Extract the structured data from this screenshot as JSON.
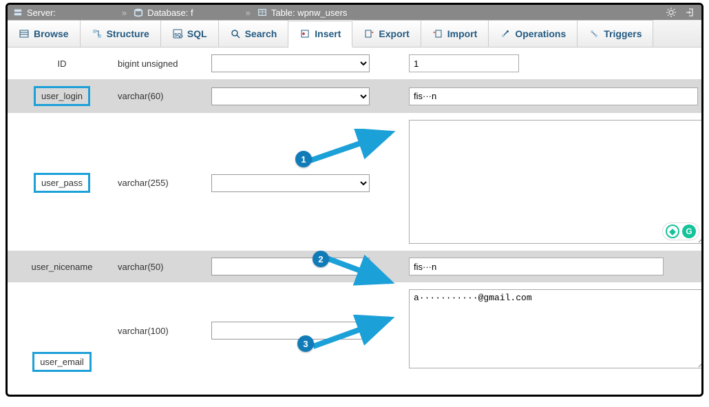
{
  "breadcrumb": {
    "server_label": "Server:",
    "server_value": "",
    "db_label": "Database: f",
    "db_value": "",
    "table_label": "Table: wpnw_users"
  },
  "tabs": [
    {
      "label": "Browse",
      "icon": "browse"
    },
    {
      "label": "Structure",
      "icon": "structure"
    },
    {
      "label": "SQL",
      "icon": "sql"
    },
    {
      "label": "Search",
      "icon": "search"
    },
    {
      "label": "Insert",
      "icon": "insert",
      "active": true
    },
    {
      "label": "Export",
      "icon": "export"
    },
    {
      "label": "Import",
      "icon": "import"
    },
    {
      "label": "Operations",
      "icon": "operations"
    },
    {
      "label": "Triggers",
      "icon": "triggers"
    }
  ],
  "rows": {
    "id": {
      "name": "ID",
      "type": "bigint unsigned",
      "value": "1",
      "boxed": false
    },
    "user_login": {
      "name": "user_login",
      "type": "varchar(60)",
      "value": "fis···n",
      "boxed": true
    },
    "user_pass": {
      "name": "user_pass",
      "type": "varchar(255)",
      "value": "",
      "boxed": true
    },
    "user_nicename": {
      "name": "user_nicename",
      "type": "varchar(50)",
      "value": "fis···n",
      "boxed": false
    },
    "user_email": {
      "name": "user_email",
      "type": "varchar(100)",
      "value": "a···········@gmail.com",
      "boxed": true
    }
  },
  "callouts": {
    "c1": "1",
    "c2": "2",
    "c3": "3"
  }
}
